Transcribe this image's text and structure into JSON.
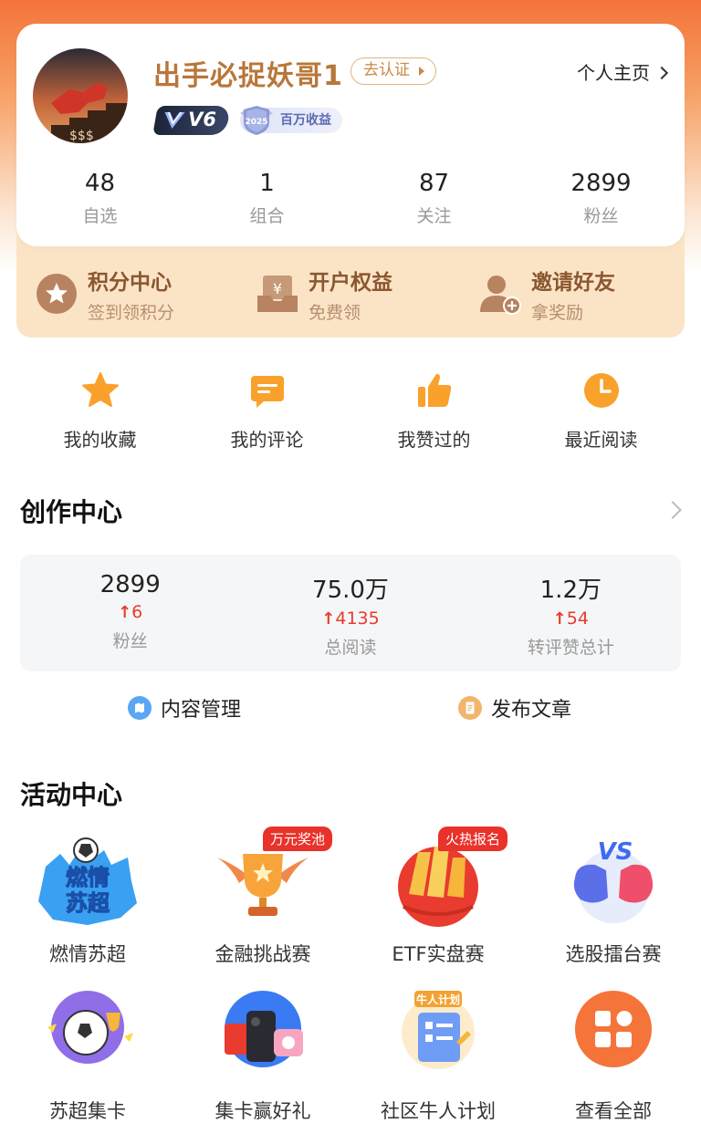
{
  "profile": {
    "username": "出手必捉妖哥1",
    "verify_label": "去认证",
    "homepage_label": "个人主页",
    "level_badge": "V6",
    "income_badge_year": "2025",
    "income_badge_label": "百万收益",
    "stats": [
      {
        "value": "48",
        "label": "自选"
      },
      {
        "value": "1",
        "label": "组合"
      },
      {
        "value": "87",
        "label": "关注"
      },
      {
        "value": "2899",
        "label": "粉丝"
      }
    ]
  },
  "benefits": [
    {
      "title": "积分中心",
      "subtitle": "签到领积分",
      "icon": "star-coin-icon"
    },
    {
      "title": "开户权益",
      "subtitle": "免费领",
      "icon": "yuan-box-icon"
    },
    {
      "title": "邀请好友",
      "subtitle": "拿奖励",
      "icon": "user-add-icon"
    }
  ],
  "quick_actions": [
    {
      "label": "我的收藏",
      "icon": "star-icon"
    },
    {
      "label": "我的评论",
      "icon": "comment-icon"
    },
    {
      "label": "我赞过的",
      "icon": "thumbs-up-icon"
    },
    {
      "label": "最近阅读",
      "icon": "clock-icon"
    }
  ],
  "creation": {
    "title": "创作中心",
    "stats": [
      {
        "value": "2899",
        "delta": "6",
        "label": "粉丝"
      },
      {
        "value": "75.0万",
        "delta": "4135",
        "label": "总阅读"
      },
      {
        "value": "1.2万",
        "delta": "54",
        "label": "转评赞总计"
      }
    ],
    "manage_label": "内容管理",
    "publish_label": "发布文章"
  },
  "activities": {
    "title": "活动中心",
    "row1": [
      {
        "label": "燃情苏超",
        "art_text_1": "燃情",
        "art_text_2": "苏超"
      },
      {
        "label": "金融挑战赛",
        "tag": "万元奖池"
      },
      {
        "label": "ETF实盘赛",
        "tag": "火热报名"
      },
      {
        "label": "选股擂台赛",
        "art_text": "VS"
      }
    ],
    "row2": [
      {
        "label": "苏超集卡"
      },
      {
        "label": "集卡赢好礼"
      },
      {
        "label": "社区牛人计划",
        "art_text": "牛人计划"
      },
      {
        "label": "查看全部"
      }
    ]
  },
  "colors": {
    "accent_orange": "#f4743a",
    "gold_text": "#b8773a",
    "delta_red": "#e83a2b"
  }
}
